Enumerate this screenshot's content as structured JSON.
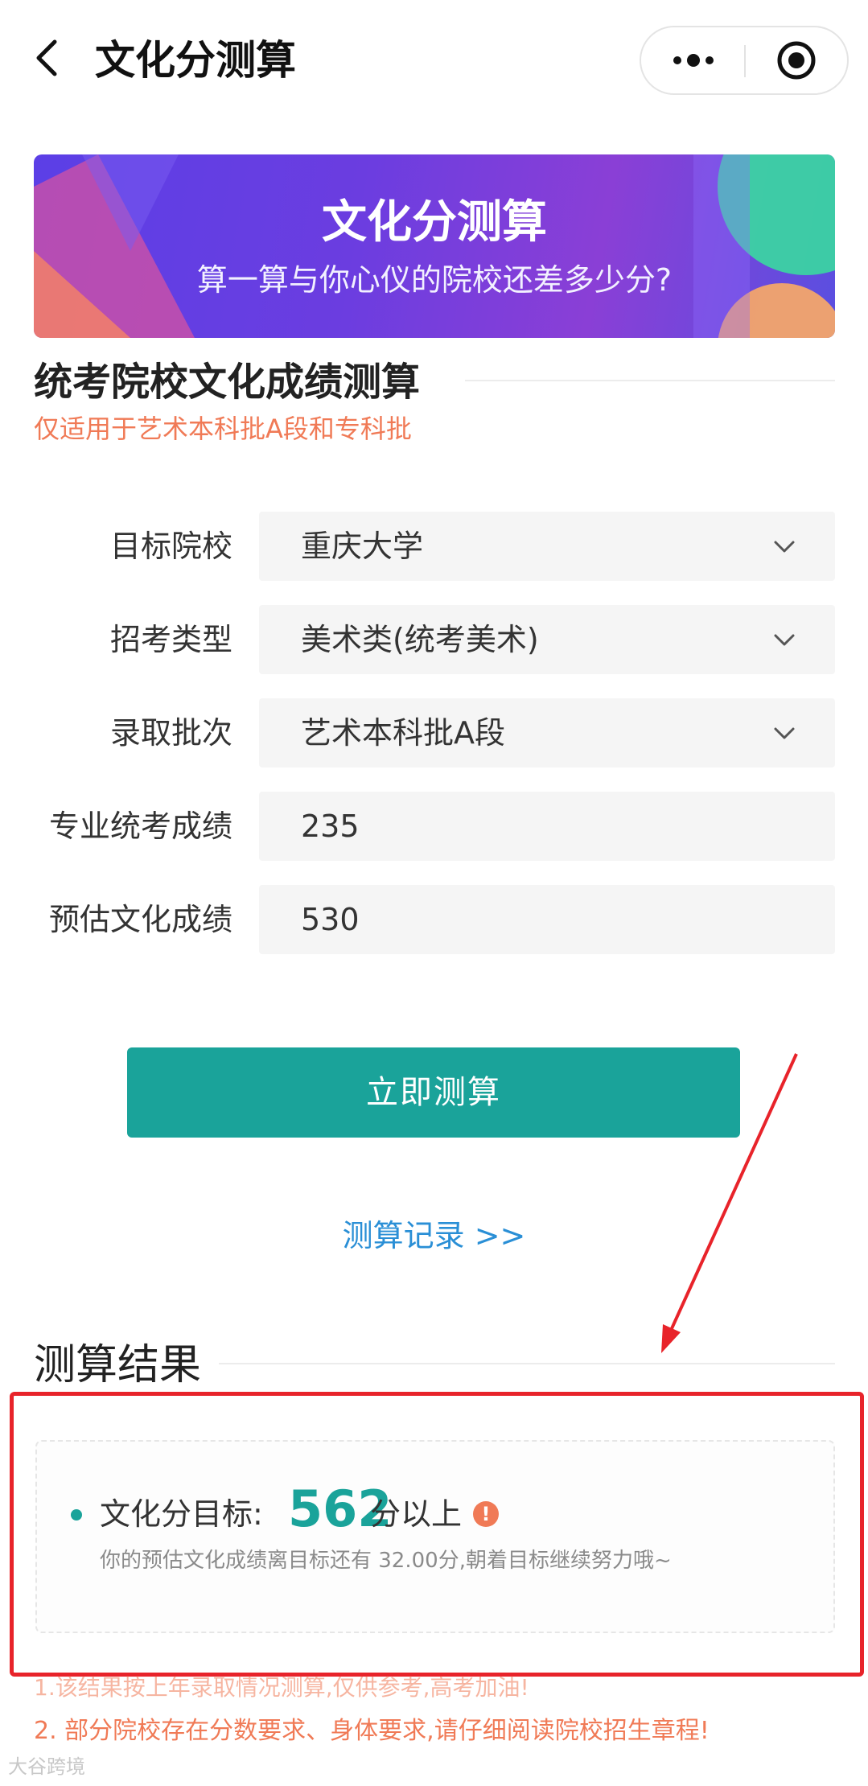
{
  "nav": {
    "title": "文化分测算",
    "back_icon": "chevron-left-icon",
    "more_icon": "more-dots-icon",
    "target_icon": "target-circle-icon"
  },
  "banner": {
    "title": "文化分测算",
    "subtitle": "算一算与你心仪的院校还差多少分?"
  },
  "section": {
    "title": "统考院校文化成绩测算",
    "note": "仅适用于艺术本科批A段和专科批"
  },
  "form": {
    "school": {
      "label": "目标院校",
      "value": "重庆大学"
    },
    "category": {
      "label": "招考类型",
      "value": "美术类(统考美术)"
    },
    "batch": {
      "label": "录取批次",
      "value": "艺术本科批A段"
    },
    "major_score": {
      "label": "专业统考成绩",
      "value": "235"
    },
    "culture_score": {
      "label": "预估文化成绩",
      "value": "530"
    }
  },
  "actions": {
    "calculate_label": "立即测算",
    "history_label": "测算记录 >>"
  },
  "result": {
    "title": "测算结果",
    "target_label": "文化分目标:",
    "target_value": "562",
    "target_suffix": "分以上",
    "warning_glyph": "!",
    "description": "你的预估文化成绩离目标还有 32.00分,朝着目标继续努力哦~"
  },
  "notes": {
    "note1": "1.该结果按上年录取情况测算,仅供参考,高考加油!",
    "note2": "2. 部分院校存在分数要求、身体要求,请仔细阅读院校招生章程!"
  },
  "watermark": "大谷跨境",
  "colors": {
    "accent": "#1aa39a",
    "warning": "#f07a56",
    "link": "#2a8fd6",
    "annotation_red": "#e8232a"
  }
}
